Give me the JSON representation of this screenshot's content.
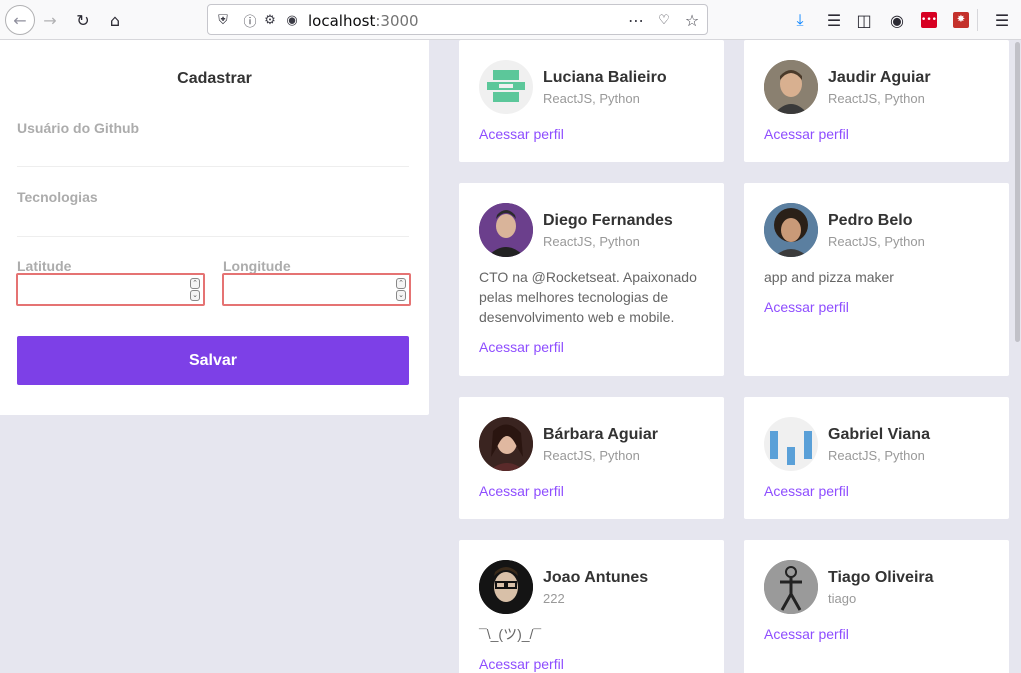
{
  "browser": {
    "url_host": "localhost",
    "url_port": ":3000",
    "icons": [
      "back-icon",
      "forward-icon",
      "reload-icon",
      "home-icon",
      "shield-icon",
      "info-icon",
      "permissions-icon",
      "site-icon",
      "more-icon",
      "pocket-icon",
      "bookmark-star-icon",
      "download-icon",
      "library-icon",
      "sidebar-icon",
      "account-icon",
      "extension-red-icon",
      "extension-bug-icon",
      "menu-icon"
    ]
  },
  "form": {
    "title": "Cadastrar",
    "github_label": "Usuário do Github",
    "techs_label": "Tecnologias",
    "latitude_label": "Latitude",
    "longitude_label": "Longitude",
    "submit_label": "Salvar"
  },
  "devs": [
    {
      "name": "Luciana Balieiro",
      "techs": "ReactJS, Python",
      "bio": "",
      "link": "Acessar perfil"
    },
    {
      "name": "Jaudir Aguiar",
      "techs": "ReactJS, Python",
      "bio": "",
      "link": "Acessar perfil"
    },
    {
      "name": "Diego Fernandes",
      "techs": "ReactJS, Python",
      "bio": "CTO na @Rocketseat. Apaixonado pelas melhores tecnologias de desenvolvimento web e mobile.",
      "link": "Acessar perfil"
    },
    {
      "name": "Pedro Belo",
      "techs": "ReactJS, Python",
      "bio": "app and pizza maker",
      "link": "Acessar perfil"
    },
    {
      "name": "Bárbara Aguiar",
      "techs": "ReactJS, Python",
      "bio": "",
      "link": "Acessar perfil"
    },
    {
      "name": "Gabriel Viana",
      "techs": "ReactJS, Python",
      "bio": "",
      "link": "Acessar perfil"
    },
    {
      "name": "Joao Antunes",
      "techs": "222",
      "bio": "¯\\_(ツ)_/¯",
      "link": "Acessar perfil"
    },
    {
      "name": "Tiago Oliveira",
      "techs": "tiago",
      "bio": "",
      "link": "Acessar perfil"
    }
  ],
  "colors": {
    "primary": "#7d40e7",
    "link": "#8e4dff",
    "background": "#e6e6ef",
    "invalid_border": "#e57373"
  }
}
